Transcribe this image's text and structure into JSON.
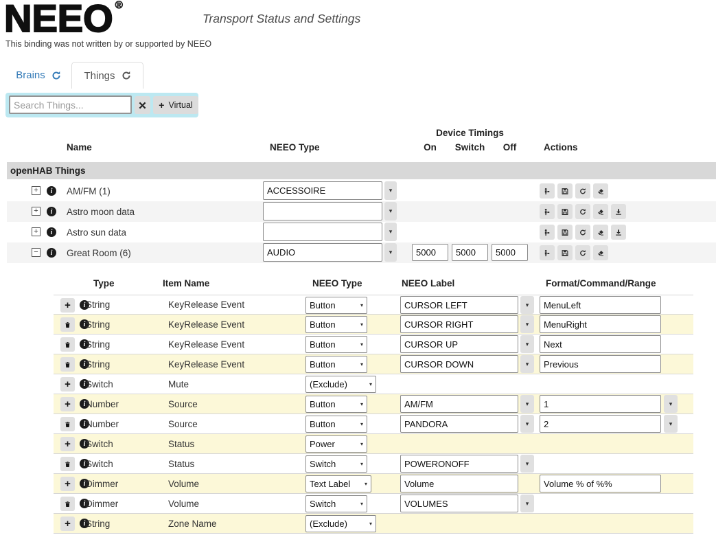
{
  "header": {
    "logo_text": "NEEO",
    "registered_mark": "®",
    "tagline": "Transport Status and Settings",
    "disclaimer": "This binding was not written by or supported by NEEO"
  },
  "tabs": {
    "brains_label": "Brains",
    "things_label": "Things"
  },
  "toolbar": {
    "search_placeholder": "Search Things...",
    "virtual_button_label": "Virtual"
  },
  "colors": {
    "accent_blue": "#337ab7",
    "search_panel": "#bce8f1",
    "row_stripe": "#f4f4f4",
    "row_yellow": "#fcf8d8",
    "group_band": "#d8d8d8",
    "button_gray": "#e0e0e0"
  },
  "things_table": {
    "column_headers": {
      "name": "Name",
      "neeo_type": "NEEO Type",
      "device_timings": "Device Timings",
      "on": "On",
      "switch": "Switch",
      "off": "Off",
      "actions": "Actions"
    },
    "group_header": "openHAB Things",
    "rows": [
      {
        "name": "AM/FM (1)",
        "expanded": false,
        "neeo_type_value": "ACCESSOIRE",
        "timings": null,
        "actions": [
          "restore",
          "save",
          "refresh",
          "erase"
        ]
      },
      {
        "name": "Astro moon data",
        "expanded": false,
        "neeo_type_value": "",
        "timings": null,
        "actions": [
          "restore",
          "save",
          "refresh",
          "erase",
          "export"
        ]
      },
      {
        "name": "Astro sun data",
        "expanded": false,
        "neeo_type_value": "",
        "timings": null,
        "actions": [
          "restore",
          "save",
          "refresh",
          "erase",
          "export"
        ]
      },
      {
        "name": "Great Room (6)",
        "expanded": true,
        "neeo_type_value": "AUDIO",
        "timings": {
          "on": "5000",
          "switch": "5000",
          "off": "5000"
        },
        "actions": [
          "restore",
          "save",
          "refresh",
          "erase"
        ]
      }
    ]
  },
  "channels_table": {
    "column_headers": {
      "type": "Type",
      "item_name": "Item Name",
      "neeo_type": "NEEO Type",
      "neeo_label": "NEEO Label",
      "format": "Format/Command/Range"
    },
    "rows": [
      {
        "action": "add",
        "type": "String",
        "item_name": "KeyRelease Event",
        "neeo_type": "Button",
        "label": "CURSOR LEFT",
        "label_dropdown": true,
        "format": "MenuLeft",
        "format_dropdown": false
      },
      {
        "action": "delete",
        "type": "String",
        "item_name": "KeyRelease Event",
        "neeo_type": "Button",
        "label": "CURSOR RIGHT",
        "label_dropdown": true,
        "format": "MenuRight",
        "format_dropdown": false
      },
      {
        "action": "delete",
        "type": "String",
        "item_name": "KeyRelease Event",
        "neeo_type": "Button",
        "label": "CURSOR UP",
        "label_dropdown": true,
        "format": "Next",
        "format_dropdown": false
      },
      {
        "action": "delete",
        "type": "String",
        "item_name": "KeyRelease Event",
        "neeo_type": "Button",
        "label": "CURSOR DOWN",
        "label_dropdown": true,
        "format": "Previous",
        "format_dropdown": false
      },
      {
        "action": "add",
        "type": "Switch",
        "item_name": "Mute",
        "neeo_type": "(Exclude)",
        "label": null,
        "label_dropdown": false,
        "format": null,
        "format_dropdown": false
      },
      {
        "action": "add",
        "type": "Number",
        "item_name": "Source",
        "neeo_type": "Button",
        "label": "AM/FM",
        "label_dropdown": true,
        "format": "1",
        "format_dropdown": true
      },
      {
        "action": "delete",
        "type": "Number",
        "item_name": "Source",
        "neeo_type": "Button",
        "label": "PANDORA",
        "label_dropdown": true,
        "format": "2",
        "format_dropdown": true
      },
      {
        "action": "add",
        "type": "Switch",
        "item_name": "Status",
        "neeo_type": "Power",
        "label": null,
        "label_dropdown": false,
        "format": null,
        "format_dropdown": false
      },
      {
        "action": "delete",
        "type": "Switch",
        "item_name": "Status",
        "neeo_type": "Switch",
        "label": "POWERONOFF",
        "label_dropdown": true,
        "format": null,
        "format_dropdown": false
      },
      {
        "action": "add",
        "type": "Dimmer",
        "item_name": "Volume",
        "neeo_type": "Text Label",
        "label": "Volume",
        "label_dropdown": false,
        "format": "Volume % of %%",
        "format_dropdown": false
      },
      {
        "action": "delete",
        "type": "Dimmer",
        "item_name": "Volume",
        "neeo_type": "Switch",
        "label": "VOLUMES",
        "label_dropdown": true,
        "format": null,
        "format_dropdown": false
      },
      {
        "action": "add",
        "type": "String",
        "item_name": "Zone Name",
        "neeo_type": "(Exclude)",
        "label": null,
        "label_dropdown": false,
        "format": null,
        "format_dropdown": false
      }
    ]
  }
}
